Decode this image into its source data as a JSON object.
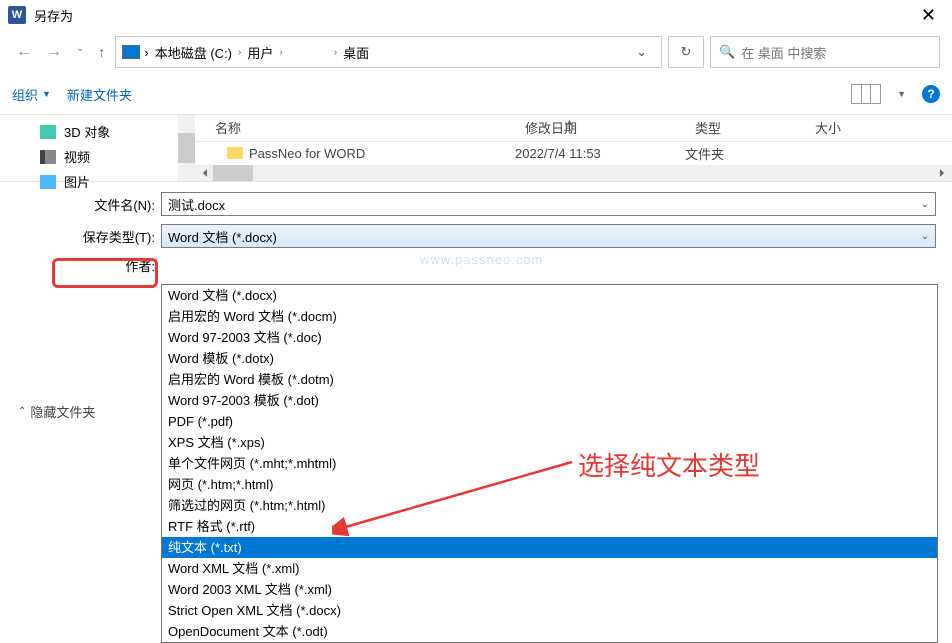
{
  "titlebar": {
    "title": "另存为"
  },
  "breadcrumb": {
    "drive": "本地磁盘 (C:)",
    "users": "用户",
    "desktop": "桌面"
  },
  "search": {
    "placeholder": "在 桌面 中搜索"
  },
  "toolbar": {
    "organize": "组织",
    "new_folder": "新建文件夹"
  },
  "sidebar": {
    "items": [
      {
        "label": "3D 对象"
      },
      {
        "label": "视频"
      },
      {
        "label": "图片"
      }
    ]
  },
  "columns": {
    "name": "名称",
    "date": "修改日期",
    "type": "类型",
    "size": "大小"
  },
  "files": [
    {
      "name": "PassNeo for WORD",
      "date": "2022/7/4 11:53",
      "type": "文件夹"
    }
  ],
  "form": {
    "filename_label": "文件名(N):",
    "filename_value": "测试.docx",
    "savetype_label": "保存类型(T):",
    "savetype_value": "Word 文档 (*.docx)",
    "author_label": "作者:"
  },
  "filetype_options": [
    "Word 文档 (*.docx)",
    "启用宏的 Word 文档 (*.docm)",
    "Word 97-2003 文档 (*.doc)",
    "Word 模板 (*.dotx)",
    "启用宏的 Word 模板 (*.dotm)",
    "Word 97-2003 模板 (*.dot)",
    "PDF (*.pdf)",
    "XPS 文档 (*.xps)",
    "单个文件网页 (*.mht;*.mhtml)",
    "网页 (*.htm;*.html)",
    "筛选过的网页 (*.htm;*.html)",
    "RTF 格式 (*.rtf)",
    "纯文本 (*.txt)",
    "Word XML 文档 (*.xml)",
    "Word 2003 XML 文档 (*.xml)",
    "Strict Open XML 文档 (*.docx)",
    "OpenDocument 文本 (*.odt)"
  ],
  "selected_option_index": 12,
  "hide_folders": "隐藏文件夹",
  "watermark": "www.passneo.com",
  "annotation": "选择纯文本类型"
}
